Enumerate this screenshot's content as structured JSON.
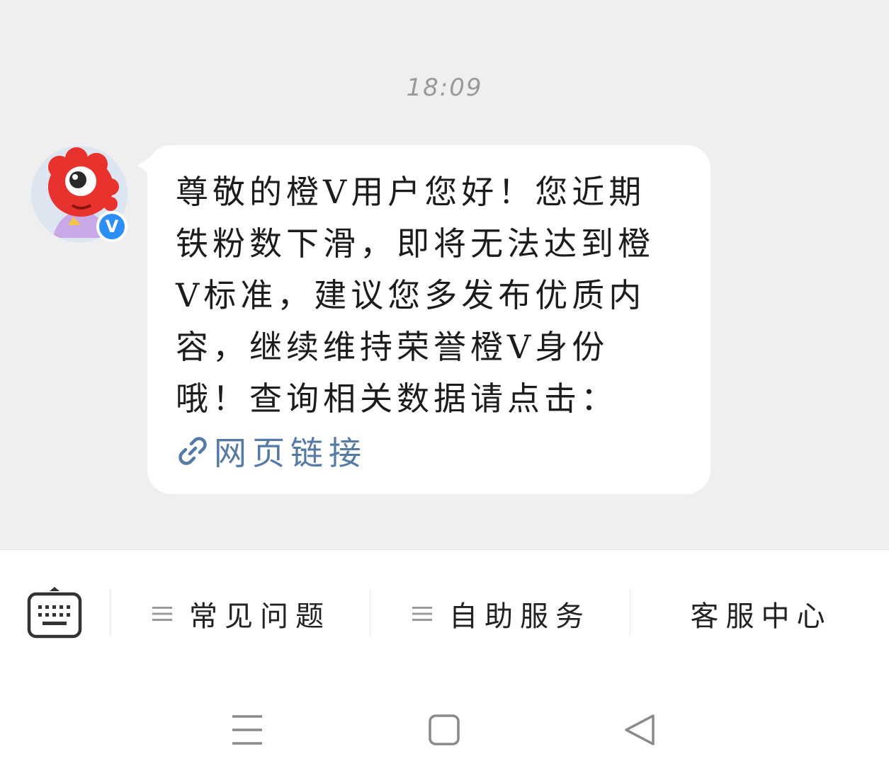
{
  "timestamp": "18:09",
  "sender": {
    "avatar_icon": "weibo-mascot-avatar",
    "badge_text": "V",
    "badge_color": "#2c8ef7"
  },
  "message": {
    "text": "尊敬的橙V用户您好！您近期铁粉数下滑，即将无法达到橙V标准，建议您多发布优质内容，继续维持荣誉橙V身份哦！查询相关数据请点击：",
    "link_icon": "link-icon",
    "link_text": "网页链接",
    "link_color": "#557aa6"
  },
  "menu": {
    "keyboard_icon": "keyboard-icon",
    "items": [
      {
        "label": "常见问题",
        "icon": "hamburger-icon"
      },
      {
        "label": "自助服务",
        "icon": "hamburger-icon"
      },
      {
        "label": "客服中心"
      }
    ]
  },
  "nav": {
    "buttons": [
      "menu-icon",
      "home-icon",
      "back-icon"
    ]
  }
}
